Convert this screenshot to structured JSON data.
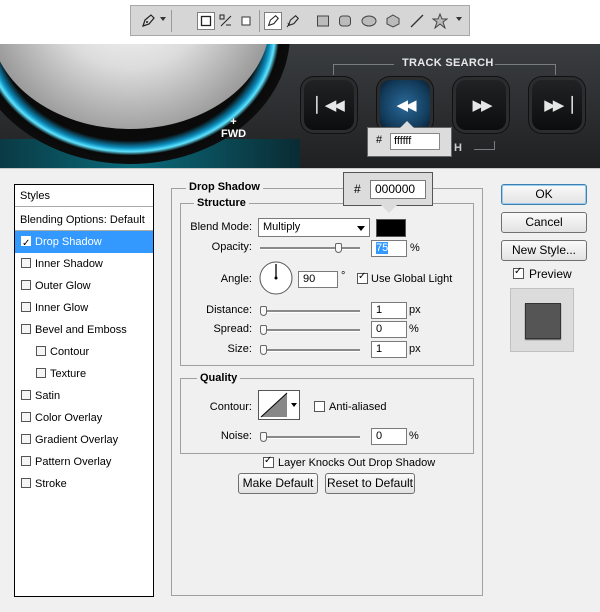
{
  "toolbar": {
    "tools": [
      "pen-icon",
      "shape-layers-icon",
      "paths-icon",
      "fill-pixels-icon",
      "pen-tool-icon",
      "freeform-pen-icon",
      "rectangle-icon",
      "rounded-rectangle-icon",
      "ellipse-icon",
      "polygon-icon",
      "line-icon",
      "custom-shape-icon"
    ]
  },
  "banner": {
    "fwd_plus": "+",
    "fwd_label": "FWD",
    "track_search": "TRACK SEARCH",
    "hidden_label_fragment": "H",
    "hex_hash": "#",
    "hex_value": "ffffff",
    "buttons": [
      "rewind-to-start",
      "rewind",
      "fast-forward",
      "skip-to-end"
    ]
  },
  "dialog": {
    "styles_header": "Styles",
    "blending_options": "Blending Options: Default",
    "styles": [
      {
        "label": "Drop Shadow",
        "checked": true,
        "selected": true,
        "sub": false
      },
      {
        "label": "Inner Shadow",
        "checked": false,
        "selected": false,
        "sub": false
      },
      {
        "label": "Outer Glow",
        "checked": false,
        "selected": false,
        "sub": false
      },
      {
        "label": "Inner Glow",
        "checked": false,
        "selected": false,
        "sub": false
      },
      {
        "label": "Bevel and Emboss",
        "checked": false,
        "selected": false,
        "sub": false
      },
      {
        "label": "Contour",
        "checked": false,
        "selected": false,
        "sub": true
      },
      {
        "label": "Texture",
        "checked": false,
        "selected": false,
        "sub": true
      },
      {
        "label": "Satin",
        "checked": false,
        "selected": false,
        "sub": false
      },
      {
        "label": "Color Overlay",
        "checked": false,
        "selected": false,
        "sub": false
      },
      {
        "label": "Gradient Overlay",
        "checked": false,
        "selected": false,
        "sub": false
      },
      {
        "label": "Pattern Overlay",
        "checked": false,
        "selected": false,
        "sub": false
      },
      {
        "label": "Stroke",
        "checked": false,
        "selected": false,
        "sub": false
      }
    ],
    "drop_shadow_title": "Drop Shadow",
    "structure_title": "Structure",
    "blend_mode_label": "Blend Mode:",
    "blend_mode_value": "Multiply",
    "shadow_color": "#000000",
    "color_hash": "#",
    "color_hex": "000000",
    "opacity_label": "Opacity:",
    "opacity_value": "75",
    "opacity_level": 0.75,
    "percent": "%",
    "angle_label": "Angle:",
    "angle_value": "90",
    "degree": "°",
    "use_global_light": "Use Global Light",
    "distance_label": "Distance:",
    "distance_value": "1",
    "spread_label": "Spread:",
    "spread_value": "0",
    "size_label": "Size:",
    "size_value": "1",
    "px": "px",
    "quality_title": "Quality",
    "contour_label": "Contour:",
    "anti_aliased": "Anti-aliased",
    "noise_label": "Noise:",
    "noise_value": "0",
    "layer_knocks_out": "Layer Knocks Out Drop Shadow",
    "make_default": "Make Default",
    "reset_to_default": "Reset to Default",
    "ok": "OK",
    "cancel": "Cancel",
    "new_style": "New Style...",
    "preview": "Preview"
  }
}
